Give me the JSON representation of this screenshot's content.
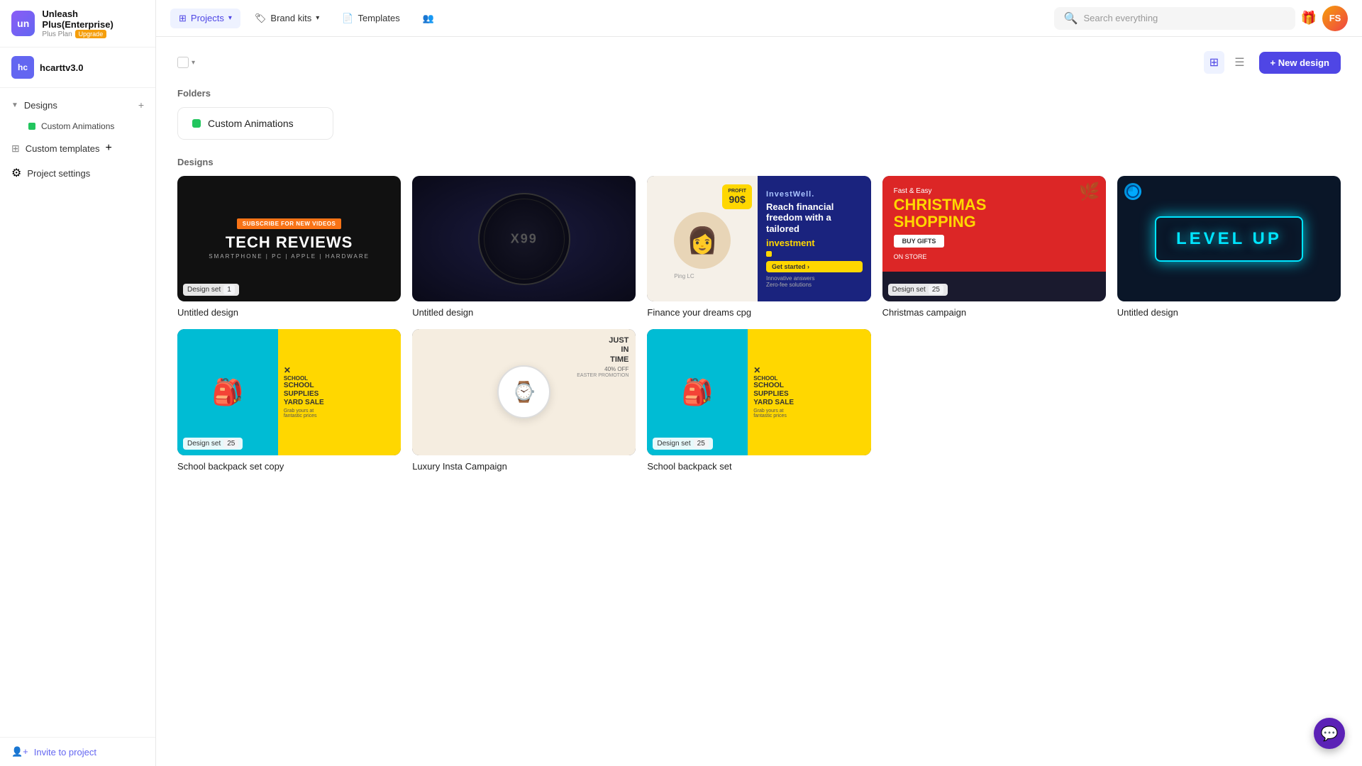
{
  "app": {
    "name": "Unleash Plus(Enterprise)",
    "plan": "Plus Plan",
    "upgrade_label": "Upgrade",
    "logo_initials": "un"
  },
  "workspace": {
    "initials": "hc",
    "name": "hcarttv3.0"
  },
  "sidebar": {
    "designs_label": "Designs",
    "custom_animations_label": "Custom Animations",
    "custom_templates_label": "Custom templates",
    "project_settings_label": "Project settings",
    "invite_label": "Invite to project"
  },
  "topnav": {
    "projects_label": "Projects",
    "brand_kits_label": "Brand kits",
    "templates_label": "Templates",
    "search_placeholder": "Search everything",
    "user_initials": "FS"
  },
  "toolbar": {
    "new_design_label": "+ New design",
    "folders_section": "Folders",
    "designs_section": "Designs"
  },
  "folders": [
    {
      "name": "Custom Animations",
      "color": "#22c55e"
    }
  ],
  "designs": [
    {
      "id": "d1",
      "name": "Untitled design",
      "type": "tech_reviews",
      "badge": "Design set",
      "badge_count": "1"
    },
    {
      "id": "d2",
      "name": "Untitled design",
      "type": "motherboard",
      "badge": null
    },
    {
      "id": "d3",
      "name": "Finance your dreams cpg",
      "type": "finance",
      "badge": null
    },
    {
      "id": "d4",
      "name": "Christmas campaign",
      "type": "christmas",
      "badge": "Design set",
      "badge_count": "25"
    },
    {
      "id": "d5",
      "name": "Untitled design",
      "type": "levelup",
      "badge": null
    },
    {
      "id": "d6",
      "name": "School backpack set copy",
      "type": "school",
      "badge": "Design set",
      "badge_count": "25"
    },
    {
      "id": "d7",
      "name": "Luxury Insta Campaign",
      "type": "luxury",
      "badge": null
    },
    {
      "id": "d8",
      "name": "School backpack set",
      "type": "school2",
      "badge": "Design set",
      "badge_count": "25"
    }
  ]
}
